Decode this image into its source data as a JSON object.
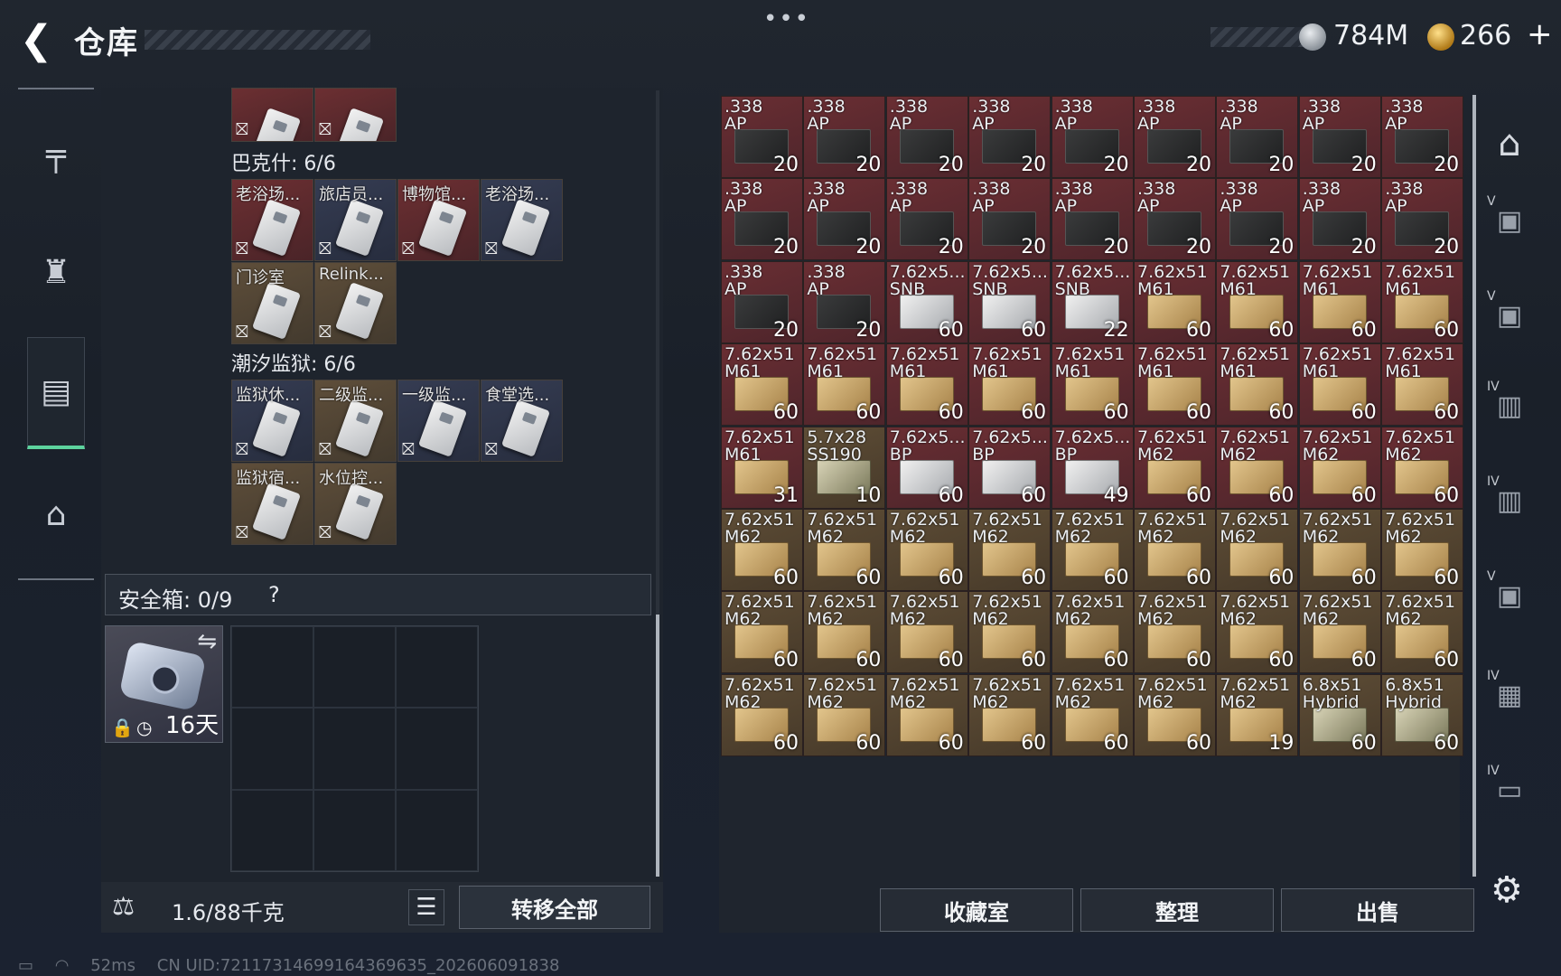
{
  "header": {
    "back_icon": "back-arrow-icon",
    "title": "仓库",
    "dots": "•••",
    "silver_value": "784M",
    "gold_value": "266",
    "plus": "+"
  },
  "left_nav": [
    {
      "name": "weapon-icon",
      "glyph": "╤"
    },
    {
      "name": "backpack-icon",
      "glyph": "♜"
    },
    {
      "name": "container-icon",
      "glyph": "▤",
      "active": true
    },
    {
      "name": "briefcase-icon",
      "glyph": "⌂"
    }
  ],
  "keys": {
    "top_row": [
      {
        "label": "",
        "color": "red",
        "nolink": "⛝"
      },
      {
        "label": "",
        "color": "red",
        "nolink": "⛝"
      }
    ],
    "section1": {
      "label": "巴克什: 6/6",
      "items": [
        {
          "label": "老浴场...",
          "color": "red"
        },
        {
          "label": "旅店员...",
          "color": "blue"
        },
        {
          "label": "博物馆...",
          "color": "red"
        },
        {
          "label": "老浴场...",
          "color": "blue"
        },
        {
          "label": "门诊室",
          "color": "tan"
        },
        {
          "label": "Relink...",
          "color": "tan"
        }
      ]
    },
    "section2": {
      "label": "潮汐监狱: 6/6",
      "items": [
        {
          "label": "监狱休...",
          "color": "blue"
        },
        {
          "label": "二级监...",
          "color": "tan"
        },
        {
          "label": "一级监...",
          "color": "blue"
        },
        {
          "label": "食堂选...",
          "color": "blue"
        },
        {
          "label": "监狱宿...",
          "color": "tan"
        },
        {
          "label": "水位控...",
          "color": "tan"
        }
      ]
    }
  },
  "safe": {
    "label": "安全箱: 0/9",
    "help": "?",
    "swap_icon": "⇋",
    "lock_icon": "🔒",
    "clock_icon": "◷",
    "days": "16天"
  },
  "bottom_left": {
    "weight_icon": "⚖",
    "weight": "1.6/88千克",
    "list_icon": "☰",
    "transfer_label": "转移全部"
  },
  "ammo_grid": [
    [
      ".338\nAP",
      "20",
      "red",
      "dark"
    ],
    [
      ".338\nAP",
      "20",
      "red",
      "dark"
    ],
    [
      ".338\nAP",
      "20",
      "red",
      "dark"
    ],
    [
      ".338\nAP",
      "20",
      "red",
      "dark"
    ],
    [
      ".338\nAP",
      "20",
      "red",
      "dark"
    ],
    [
      ".338\nAP",
      "20",
      "red",
      "dark"
    ],
    [
      ".338\nAP",
      "20",
      "red",
      "dark"
    ],
    [
      ".338\nAP",
      "20",
      "red",
      "dark"
    ],
    [
      ".338\nAP",
      "20",
      "red",
      "dark"
    ],
    [
      ".338\nAP",
      "20",
      "red",
      "dark"
    ],
    [
      ".338\nAP",
      "20",
      "red",
      "dark"
    ],
    [
      ".338\nAP",
      "20",
      "red",
      "dark"
    ],
    [
      ".338\nAP",
      "20",
      "red",
      "dark"
    ],
    [
      ".338\nAP",
      "20",
      "red",
      "dark"
    ],
    [
      ".338\nAP",
      "20",
      "red",
      "dark"
    ],
    [
      ".338\nAP",
      "20",
      "red",
      "dark"
    ],
    [
      ".338\nAP",
      "20",
      "red",
      "dark"
    ],
    [
      ".338\nAP",
      "20",
      "red",
      "dark"
    ],
    [
      ".338\nAP",
      "20",
      "red",
      "dark"
    ],
    [
      ".338\nAP",
      "20",
      "red",
      "dark"
    ],
    [
      "7.62x5...\nSNB",
      "60",
      "red",
      "white"
    ],
    [
      "7.62x5...\nSNB",
      "60",
      "red",
      "white"
    ],
    [
      "7.62x5...\nSNB",
      "22",
      "red",
      "white"
    ],
    [
      "7.62x51\nM61",
      "60",
      "red",
      "gold"
    ],
    [
      "7.62x51\nM61",
      "60",
      "red",
      "gold"
    ],
    [
      "7.62x51\nM61",
      "60",
      "red",
      "gold"
    ],
    [
      "7.62x51\nM61",
      "60",
      "red",
      "gold"
    ],
    [
      "7.62x51\nM61",
      "60",
      "red",
      "gold"
    ],
    [
      "7.62x51\nM61",
      "60",
      "red",
      "gold"
    ],
    [
      "7.62x51\nM61",
      "60",
      "red",
      "gold"
    ],
    [
      "7.62x51\nM61",
      "60",
      "red",
      "gold"
    ],
    [
      "7.62x51\nM61",
      "60",
      "red",
      "gold"
    ],
    [
      "7.62x51\nM61",
      "60",
      "red",
      "gold"
    ],
    [
      "7.62x51\nM61",
      "60",
      "red",
      "gold"
    ],
    [
      "7.62x51\nM61",
      "60",
      "red",
      "gold"
    ],
    [
      "7.62x51\nM61",
      "60",
      "red",
      "gold"
    ],
    [
      "7.62x51\nM61",
      "31",
      "red",
      "gold"
    ],
    [
      "5.7x28\nSS190",
      "10",
      "tan",
      "olive"
    ],
    [
      "7.62x5...\nBP",
      "60",
      "red",
      "white"
    ],
    [
      "7.62x5...\nBP",
      "60",
      "red",
      "white"
    ],
    [
      "7.62x5...\nBP",
      "49",
      "red",
      "white"
    ],
    [
      "7.62x51\nM62",
      "60",
      "red",
      "gold"
    ],
    [
      "7.62x51\nM62",
      "60",
      "red",
      "gold"
    ],
    [
      "7.62x51\nM62",
      "60",
      "red",
      "gold"
    ],
    [
      "7.62x51\nM62",
      "60",
      "red",
      "gold"
    ],
    [
      "7.62x51\nM62",
      "60",
      "tan",
      "gold"
    ],
    [
      "7.62x51\nM62",
      "60",
      "tan",
      "gold"
    ],
    [
      "7.62x51\nM62",
      "60",
      "tan",
      "gold"
    ],
    [
      "7.62x51\nM62",
      "60",
      "tan",
      "gold"
    ],
    [
      "7.62x51\nM62",
      "60",
      "tan",
      "gold"
    ],
    [
      "7.62x51\nM62",
      "60",
      "tan",
      "gold"
    ],
    [
      "7.62x51\nM62",
      "60",
      "tan",
      "gold"
    ],
    [
      "7.62x51\nM62",
      "60",
      "tan",
      "gold"
    ],
    [
      "7.62x51\nM62",
      "60",
      "tan",
      "gold"
    ],
    [
      "7.62x51\nM62",
      "60",
      "tan",
      "gold"
    ],
    [
      "7.62x51\nM62",
      "60",
      "tan",
      "gold"
    ],
    [
      "7.62x51\nM62",
      "60",
      "tan",
      "gold"
    ],
    [
      "7.62x51\nM62",
      "60",
      "tan",
      "gold"
    ],
    [
      "7.62x51\nM62",
      "60",
      "tan",
      "gold"
    ],
    [
      "7.62x51\nM62",
      "60",
      "tan",
      "gold"
    ],
    [
      "7.62x51\nM62",
      "60",
      "tan",
      "gold"
    ],
    [
      "7.62x51\nM62",
      "60",
      "tan",
      "gold"
    ],
    [
      "7.62x51\nM62",
      "60",
      "tan",
      "gold"
    ],
    [
      "7.62x51\nM62",
      "60",
      "tan",
      "gold"
    ],
    [
      "7.62x51\nM62",
      "60",
      "tan",
      "gold"
    ],
    [
      "7.62x51\nM62",
      "60",
      "tan",
      "gold"
    ],
    [
      "7.62x51\nM62",
      "60",
      "tan",
      "gold"
    ],
    [
      "7.62x51\nM62",
      "60",
      "tan",
      "gold"
    ],
    [
      "7.62x51\nM62",
      "60",
      "tan",
      "gold"
    ],
    [
      "7.62x51\nM62",
      "19",
      "tan",
      "gold"
    ],
    [
      "6.8x51\nHybrid",
      "60",
      "tan",
      "olive"
    ],
    [
      "6.8x51\nHybrid",
      "60",
      "tan",
      "olive"
    ]
  ],
  "right_buttons": [
    "收藏室",
    "整理",
    "出售"
  ],
  "right_nav": [
    {
      "name": "home-icon",
      "glyph": "⌂",
      "tier": ""
    },
    {
      "name": "loadout-icon",
      "glyph": "▣",
      "tier": "V"
    },
    {
      "name": "loadout-icon",
      "glyph": "▣",
      "tier": "V"
    },
    {
      "name": "folder-icon",
      "glyph": "▥",
      "tier": "IV"
    },
    {
      "name": "folder-icon",
      "glyph": "▥",
      "tier": "IV"
    },
    {
      "name": "loadout-icon",
      "glyph": "▣",
      "tier": "V"
    },
    {
      "name": "crate-icon",
      "glyph": "▦",
      "tier": "IV"
    },
    {
      "name": "rack-icon",
      "glyph": "▭",
      "tier": "IV"
    }
  ],
  "settings_icon": "⚙",
  "status": {
    "ping": "52ms",
    "uid": "CN UID:7211731469916436963​5_202606091838"
  }
}
